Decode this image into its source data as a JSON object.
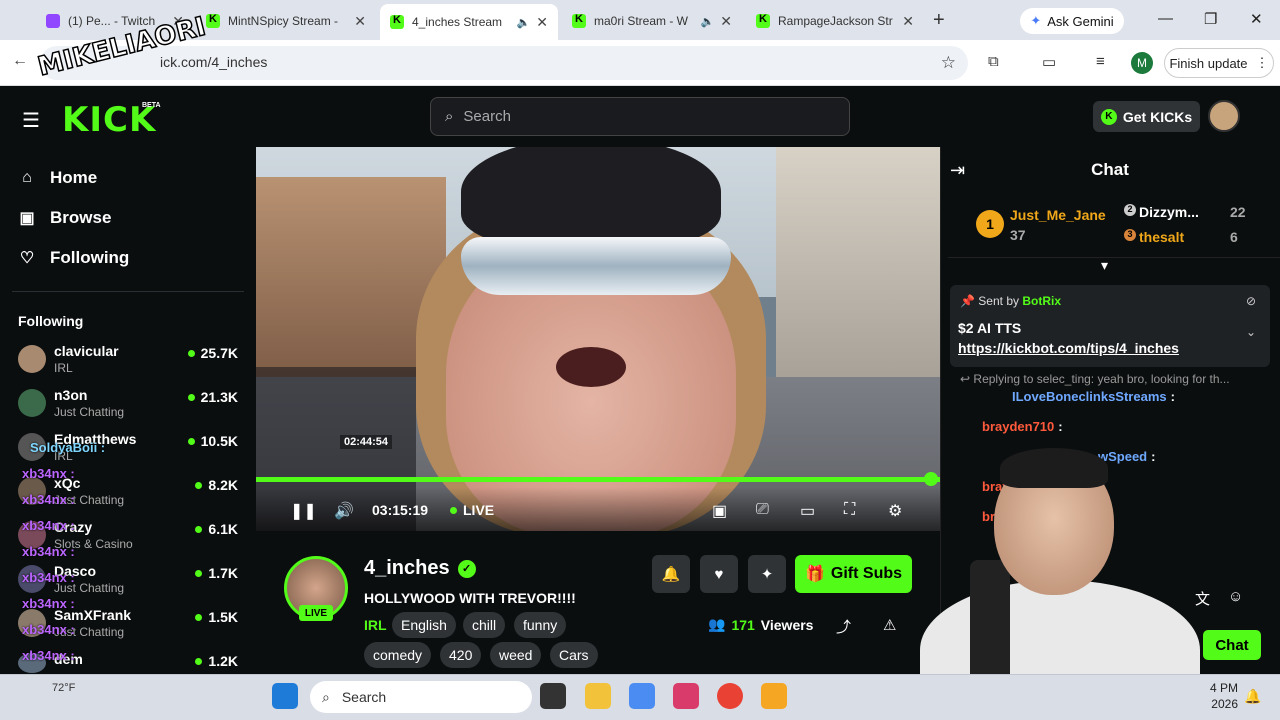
{
  "browser": {
    "tabs": [
      {
        "title": "(1) Pe... - Twitch"
      },
      {
        "title": "MintNSpicy Stream -"
      },
      {
        "title": "4_inches Stream"
      },
      {
        "title": "ma0ri Stream - W"
      },
      {
        "title": "RampageJackson Str"
      }
    ],
    "gemini_label": "Ask Gemini",
    "url": "ick.com/4_inches",
    "profile_initial": "M",
    "finish_update": "Finish update"
  },
  "header": {
    "logo": "KICK",
    "beta": "BETA",
    "search_placeholder": "Search",
    "get_kicks": "Get KICKs"
  },
  "sidebar": {
    "nav": [
      {
        "label": "Home"
      },
      {
        "label": "Browse"
      },
      {
        "label": "Following"
      }
    ],
    "following_header": "Following",
    "channels": [
      {
        "name": "clavicular",
        "category": "IRL",
        "viewers": "25.7K"
      },
      {
        "name": "n3on",
        "category": "Just Chatting",
        "viewers": "21.3K"
      },
      {
        "name": "Edmatthews",
        "category": "IRL",
        "viewers": "10.5K"
      },
      {
        "name": "xQc",
        "category": "Just Chatting",
        "viewers": "8.2K"
      },
      {
        "name": "Crazy",
        "category": "Slots & Casino",
        "viewers": "6.1K"
      },
      {
        "name": "Dasco",
        "category": "Just Chatting",
        "viewers": "1.7K"
      },
      {
        "name": "SamXFrank",
        "category": "Just Chatting",
        "viewers": "1.5K"
      },
      {
        "name": "dem",
        "category": "",
        "viewers": "1.2K"
      }
    ],
    "overlay_names": [
      "SoldyaBoii :",
      "xb34nx :",
      "xb34nx :",
      "xb34nx :",
      "xb34nx :",
      "xb34nx :",
      "xb34nx :",
      "xb34nx :",
      "xb34nx :",
      "xb34nx"
    ]
  },
  "player": {
    "seek_time": "02:44:54",
    "time": "03:15:19",
    "live": "LIVE"
  },
  "stream": {
    "channel": "4_inches",
    "live_badge": "LIVE",
    "title": "HOLLYWOOD WITH TREVOR!!!!",
    "category": "IRL",
    "tags": [
      "English",
      "chill",
      "funny",
      "comedy",
      "420",
      "weed",
      "Cars"
    ],
    "gift_subs": "Gift Subs",
    "viewer_count": "171",
    "viewers_label": "Viewers"
  },
  "chat": {
    "title": "Chat",
    "leaderboard": [
      {
        "rank": "1",
        "name": "Just_Me_Jane",
        "count": "37"
      },
      {
        "rank": "2",
        "name": "Dizzym...",
        "count": "22"
      },
      {
        "rank": "3",
        "name": "thesalt",
        "count": "6"
      }
    ],
    "pinned": {
      "sent_by_label": "Sent by",
      "sender": "BotRix",
      "message": "$2 AI TTS",
      "link": "https://kickbot.com/tips/4_inches"
    },
    "reply_text": "Replying to selec_ting: yeah bro, looking for th...",
    "messages": [
      {
        "user": "ILoveBoneclinksStreams",
        "color": "#6fa8ff"
      },
      {
        "user": "brayden710",
        "color": "#ff5a3c"
      },
      {
        "user": "wSpeed",
        "color": "#6fa8ff"
      },
      {
        "user": "brayd",
        "color": "#ff5a3c"
      },
      {
        "user": "brayd",
        "color": "#ff5a3c"
      }
    ],
    "send_label": "Chat"
  },
  "taskbar": {
    "weather": "72°F",
    "search_label": "Search",
    "time": "4 PM",
    "date": "2026"
  },
  "watermark": "MIKELIAORI"
}
